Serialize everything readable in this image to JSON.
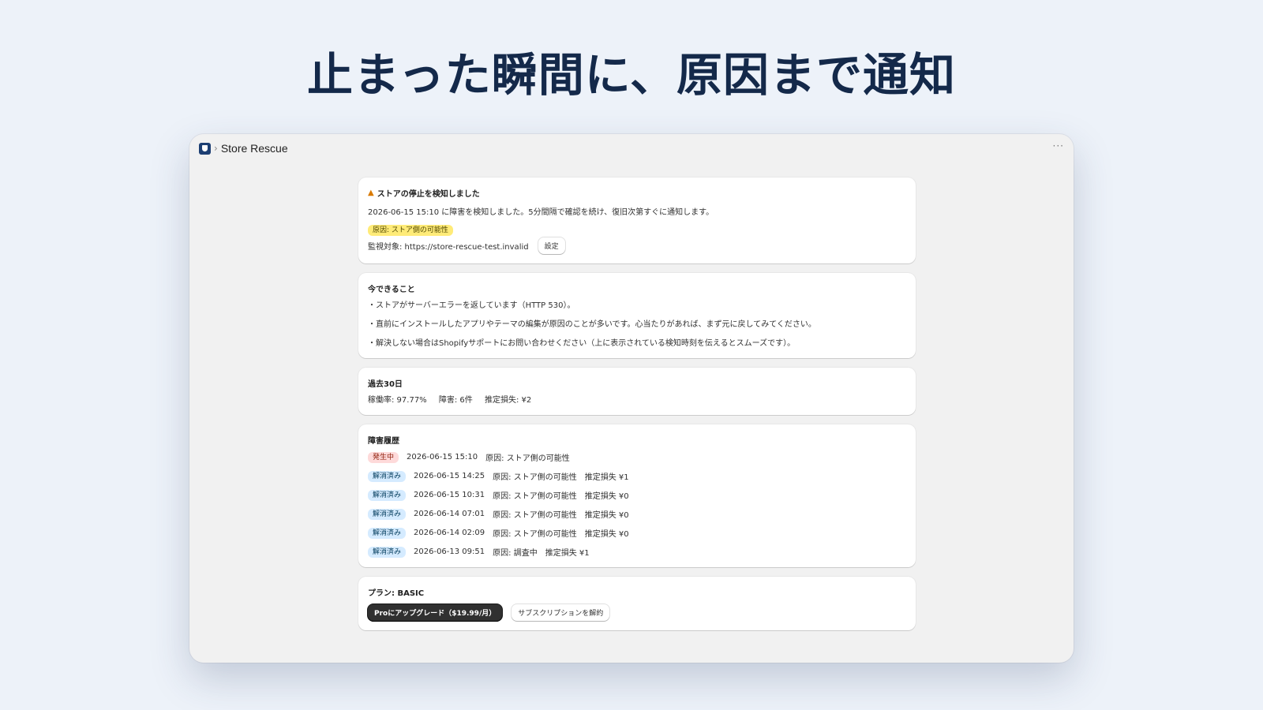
{
  "hero": {
    "title": "止まった瞬間に、原因まで通知"
  },
  "window": {
    "app_name": "Store Rescue",
    "breadcrumb_sep": "›",
    "more": "···"
  },
  "alert": {
    "title": "ストアの停止を検知しました",
    "message": "2026-06-15 15:10 に障害を検知しました。5分間隔で確認を続け、復旧次第すぐに通知します。",
    "cause_badge": "原因: ストア側の可能性",
    "monitor": "監視対象: https://store-rescue-test.invalid",
    "settings_button": "設定"
  },
  "actions": {
    "title": "今できること",
    "items": [
      "・ストアがサーバーエラーを返しています（HTTP 530）。",
      "・直前にインストールしたアプリやテーマの編集が原因のことが多いです。心当たりがあれば、まず元に戻してみてください。",
      "・解決しない場合はShopifyサポートにお問い合わせください（上に表示されている検知時刻を伝えるとスムーズです）。"
    ]
  },
  "stats": {
    "title": "過去30日",
    "uptime": "稼働率: 97.77%",
    "incidents": "障害: 6件",
    "loss": "推定損失: ¥2"
  },
  "history": {
    "title": "障害履歴",
    "rows": [
      {
        "status": "発生中",
        "status_type": "active",
        "time": "2026-06-15 15:10",
        "cause": "原因: ストア側の可能性",
        "loss": ""
      },
      {
        "status": "解消済み",
        "status_type": "resolved",
        "time": "2026-06-15 14:25",
        "cause": "原因: ストア側の可能性",
        "loss": "推定損失 ¥1"
      },
      {
        "status": "解消済み",
        "status_type": "resolved",
        "time": "2026-06-15 10:31",
        "cause": "原因: ストア側の可能性",
        "loss": "推定損失 ¥0"
      },
      {
        "status": "解消済み",
        "status_type": "resolved",
        "time": "2026-06-14 07:01",
        "cause": "原因: ストア側の可能性",
        "loss": "推定損失 ¥0"
      },
      {
        "status": "解消済み",
        "status_type": "resolved",
        "time": "2026-06-14 02:09",
        "cause": "原因: ストア側の可能性",
        "loss": "推定損失 ¥0"
      },
      {
        "status": "解消済み",
        "status_type": "resolved",
        "time": "2026-06-13 09:51",
        "cause": "原因: 調査中",
        "loss": "推定損失 ¥1"
      }
    ]
  },
  "plan": {
    "title": "プラン: BASIC",
    "upgrade_button": "Proにアップグレード（$19.99/月）",
    "cancel_button": "サブスクリプションを解約"
  }
}
